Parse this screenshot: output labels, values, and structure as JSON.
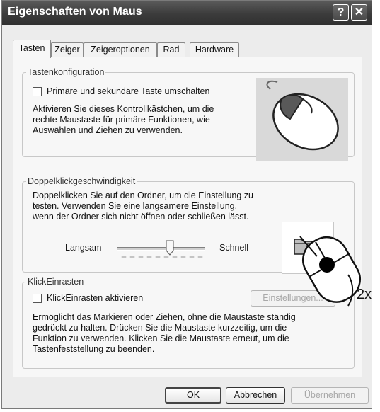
{
  "window": {
    "title": "Eigenschaften von Maus",
    "help_button": "?",
    "close_button": "✕"
  },
  "tabs": [
    {
      "label": "Tasten",
      "active": true
    },
    {
      "label": "Zeiger"
    },
    {
      "label": "Zeigeroptionen"
    },
    {
      "label": "Rad"
    },
    {
      "label": "Hardware"
    }
  ],
  "button_config": {
    "legend": "Tastenkonfiguration",
    "checkbox_label": "Primäre und sekundäre Taste umschalten",
    "checked": false,
    "description": [
      "Aktivieren Sie dieses Kontrollkästchen, um die",
      "rechte Maustaste für primäre Funktionen, wie",
      "Auswählen und Ziehen zu verwenden."
    ]
  },
  "double_click": {
    "legend": "Doppelklickgeschwindigkeit",
    "description": [
      "Doppelklicken Sie auf den Ordner, um die Einstellung zu",
      "testen. Verwenden Sie eine langsamere Einstellung,",
      "wenn der Ordner sich nicht öffnen oder schließen lässt."
    ],
    "slow_label": "Langsam",
    "fast_label": "Schnell",
    "slider_value": 0.6
  },
  "clicklock": {
    "legend": "KlickEinrasten",
    "checkbox_label": "KlickEinrasten aktivieren",
    "checked": false,
    "settings_button": "Einstellungen...",
    "description": [
      "Ermöglicht das Markieren oder Ziehen, ohne die Maustaste ständig",
      "gedrückt zu halten. Drücken Sie die Maustaste kurzzeitig, um die",
      "Funktion zu verwenden. Klicken Sie die Maustaste erneut, um die",
      "Tastenfeststellung zu beenden."
    ]
  },
  "footer": {
    "ok": "OK",
    "cancel": "Abbrechen",
    "apply": "Übernehmen"
  },
  "callout": {
    "label": "2x"
  }
}
